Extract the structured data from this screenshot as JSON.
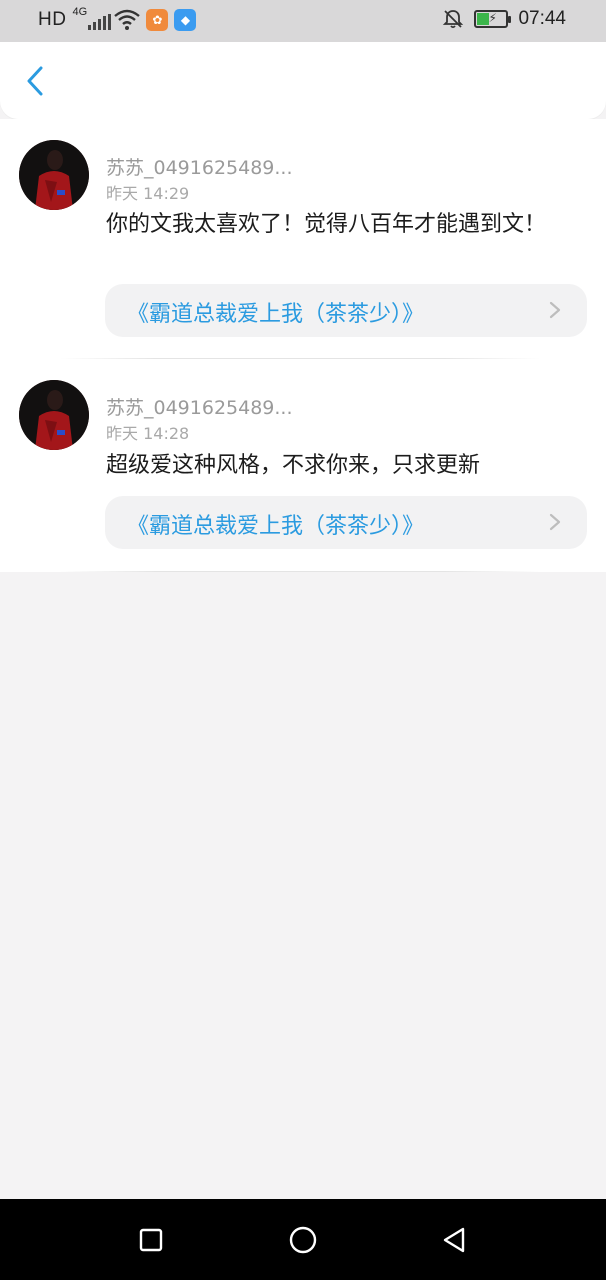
{
  "status_bar": {
    "network": "HD",
    "signal_label": "4G",
    "time": "07:44",
    "icons": [
      "signal-icon",
      "wifi-icon",
      "app-notification-orange-icon",
      "app-notification-blue-icon",
      "mute-bell-icon",
      "battery-charging-icon"
    ]
  },
  "header": {
    "back_icon": "chevron-left-icon",
    "accent_color": "#2b9be0"
  },
  "comments": [
    {
      "username": "苏苏_0491625489...",
      "time": "昨天 14:29",
      "text": "你的文我太喜欢了！觉得八百年才能遇到文！",
      "book_title": "《霸道总裁爱上我（茶茶少）》"
    },
    {
      "username": "苏苏_0491625489...",
      "time": "昨天 14:28",
      "text": "超级爱这种风格，不求你来，只求更新",
      "book_title": "《霸道总裁爱上我（茶茶少）》"
    }
  ],
  "nav_bar": {
    "icons": [
      "recents-square-icon",
      "home-circle-icon",
      "back-triangle-icon"
    ]
  }
}
